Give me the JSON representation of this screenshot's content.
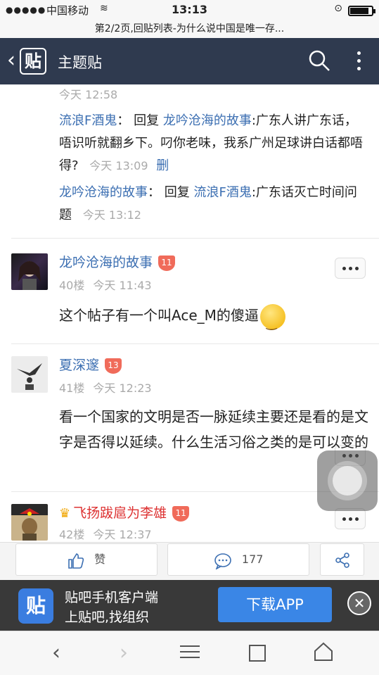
{
  "status_bar": {
    "signal": "●●●●●",
    "carrier": "中国移动",
    "wifi": "≋",
    "time": "13:13",
    "subtitle": "第2/2页,回贴列表-为什么说中国是唯一存..."
  },
  "header": {
    "back": "‹",
    "logo": "贴",
    "title": "主题贴"
  },
  "top_time": "今天 12:58",
  "replies": [
    {
      "user": "流浪F酒鬼",
      "sep": "：",
      "reply_word": "回复",
      "target": "龙吟沧海的故事",
      "text": ":广东人讲广东话，唔识听就翻乡下。叼你老味，我系广州足球讲白话都唔得?",
      "time": "今天 13:09",
      "delete": "删"
    },
    {
      "user": "龙吟沧海的故事",
      "sep": "：",
      "reply_word": "回复",
      "target": "流浪F酒鬼",
      "text": ":广东话灭亡时间问题",
      "time": "今天 13:12"
    }
  ],
  "floors": [
    {
      "name": "龙吟沧海的故事",
      "level": "11",
      "floor": "40楼",
      "time": "今天 11:43",
      "text": "这个帖子有一个叫Ace_M的傻逼"
    },
    {
      "name": "夏深邃",
      "level": "13",
      "floor": "41楼",
      "time": "今天 12:23",
      "text": "看一个国家的文明是否一脉延续主要还是看的是文字是否得以延续。什么生活习俗之类的是可以变的"
    },
    {
      "name": "飞扬跋扈为李雄",
      "level": "11",
      "floor": "42楼",
      "time": "今天 12:37"
    }
  ],
  "action_bar": {
    "like_label": "赞",
    "comment_count": "177"
  },
  "banner": {
    "logo": "贴",
    "line1": "贴吧手机客户端",
    "line2": "上贴吧,找组织",
    "download": "下载APP",
    "close": "✕"
  },
  "colors": {
    "header_bg": "#2f3a4f",
    "link": "#3c6fb2",
    "level_badge": "#f06b5a",
    "download_btn": "#3a86e6"
  }
}
